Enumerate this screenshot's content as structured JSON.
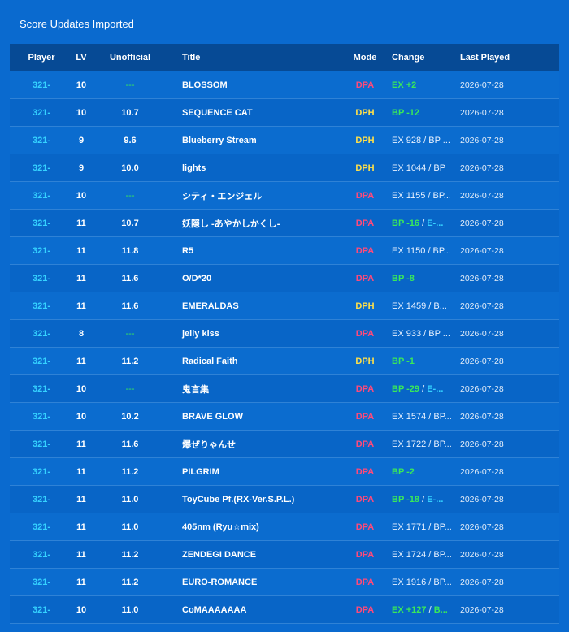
{
  "panel": {
    "title": "Score Updates Imported"
  },
  "columns": {
    "player": "Player",
    "lv": "LV",
    "unofficial": "Unofficial",
    "title": "Title",
    "mode": "Mode",
    "change": "Change",
    "last_played": "Last Played"
  },
  "colors": {
    "background": "#0a6acf",
    "header": "#064a95",
    "dpa": "#ff4a7a",
    "dph": "#ffe04a",
    "player": "#35d2ff",
    "green": "#39e85a"
  },
  "rows": [
    {
      "player": "321-",
      "lv": "10",
      "unofficial": "---",
      "title": "BLOSSOM",
      "mode": "DPA",
      "change_parts": [
        {
          "text": "EX +2",
          "style": "green"
        }
      ],
      "last_played": "2026-07-28"
    },
    {
      "player": "321-",
      "lv": "10",
      "unofficial": "10.7",
      "title": "SEQUENCE CAT",
      "mode": "DPH",
      "change_parts": [
        {
          "text": "BP -12",
          "style": "green"
        }
      ],
      "last_played": "2026-07-28"
    },
    {
      "player": "321-",
      "lv": "9",
      "unofficial": "9.6",
      "title": "Blueberry Stream",
      "mode": "DPH",
      "change_parts": [
        {
          "text": "EX 928 / BP ...",
          "style": "plain"
        }
      ],
      "last_played": "2026-07-28"
    },
    {
      "player": "321-",
      "lv": "9",
      "unofficial": "10.0",
      "title": "lights",
      "mode": "DPH",
      "change_parts": [
        {
          "text": "EX 1044 / BP",
          "style": "plain"
        }
      ],
      "last_played": "2026-07-28"
    },
    {
      "player": "321-",
      "lv": "10",
      "unofficial": "---",
      "title": "シティ・エンジェル",
      "mode": "DPA",
      "change_parts": [
        {
          "text": "EX 1155 / BP...",
          "style": "plain"
        }
      ],
      "last_played": "2026-07-28"
    },
    {
      "player": "321-",
      "lv": "11",
      "unofficial": "10.7",
      "title": "妖隠し -あやかしかくし-",
      "mode": "DPA",
      "change_parts": [
        {
          "text": "BP -16",
          "style": "green"
        },
        {
          "text": " / ",
          "style": "plain"
        },
        {
          "text": "E-...",
          "style": "blue"
        }
      ],
      "last_played": "2026-07-28"
    },
    {
      "player": "321-",
      "lv": "11",
      "unofficial": "11.8",
      "title": "R5",
      "mode": "DPA",
      "change_parts": [
        {
          "text": "EX 1150 / BP...",
          "style": "plain"
        }
      ],
      "last_played": "2026-07-28"
    },
    {
      "player": "321-",
      "lv": "11",
      "unofficial": "11.6",
      "title": "O/D*20",
      "mode": "DPA",
      "change_parts": [
        {
          "text": "BP -8",
          "style": "green"
        }
      ],
      "last_played": "2026-07-28"
    },
    {
      "player": "321-",
      "lv": "11",
      "unofficial": "11.6",
      "title": "EMERALDAS",
      "mode": "DPH",
      "change_parts": [
        {
          "text": "EX 1459 / B...",
          "style": "plain"
        }
      ],
      "last_played": "2026-07-28"
    },
    {
      "player": "321-",
      "lv": "8",
      "unofficial": "---",
      "title": "jelly kiss",
      "mode": "DPA",
      "change_parts": [
        {
          "text": "EX 933 / BP ...",
          "style": "plain"
        }
      ],
      "last_played": "2026-07-28"
    },
    {
      "player": "321-",
      "lv": "11",
      "unofficial": "11.2",
      "title": "Radical Faith",
      "mode": "DPH",
      "change_parts": [
        {
          "text": "BP -1",
          "style": "green"
        }
      ],
      "last_played": "2026-07-28"
    },
    {
      "player": "321-",
      "lv": "10",
      "unofficial": "---",
      "title": "鬼言集",
      "mode": "DPA",
      "change_parts": [
        {
          "text": "BP -29",
          "style": "green"
        },
        {
          "text": " / ",
          "style": "plain"
        },
        {
          "text": "E-...",
          "style": "blue"
        }
      ],
      "last_played": "2026-07-28"
    },
    {
      "player": "321-",
      "lv": "10",
      "unofficial": "10.2",
      "title": "BRAVE GLOW",
      "mode": "DPA",
      "change_parts": [
        {
          "text": "EX 1574 / BP...",
          "style": "plain"
        }
      ],
      "last_played": "2026-07-28"
    },
    {
      "player": "321-",
      "lv": "11",
      "unofficial": "11.6",
      "title": "爆ぜりゃんせ",
      "mode": "DPA",
      "change_parts": [
        {
          "text": "EX 1722 / BP...",
          "style": "plain"
        }
      ],
      "last_played": "2026-07-28"
    },
    {
      "player": "321-",
      "lv": "11",
      "unofficial": "11.2",
      "title": "PILGRIM",
      "mode": "DPA",
      "change_parts": [
        {
          "text": "BP -2",
          "style": "green"
        }
      ],
      "last_played": "2026-07-28"
    },
    {
      "player": "321-",
      "lv": "11",
      "unofficial": "11.0",
      "title": "ToyCube Pf.(RX-Ver.S.P.L.)",
      "mode": "DPA",
      "change_parts": [
        {
          "text": "BP -18",
          "style": "green"
        },
        {
          "text": " / ",
          "style": "plain"
        },
        {
          "text": "E-...",
          "style": "blue"
        }
      ],
      "last_played": "2026-07-28"
    },
    {
      "player": "321-",
      "lv": "11",
      "unofficial": "11.0",
      "title": "405nm (Ryu☆mix)",
      "mode": "DPA",
      "change_parts": [
        {
          "text": "EX 1771 / BP...",
          "style": "plain"
        }
      ],
      "last_played": "2026-07-28"
    },
    {
      "player": "321-",
      "lv": "11",
      "unofficial": "11.2",
      "title": "ZENDEGI DANCE",
      "mode": "DPA",
      "change_parts": [
        {
          "text": "EX 1724 / BP...",
          "style": "plain"
        }
      ],
      "last_played": "2026-07-28"
    },
    {
      "player": "321-",
      "lv": "11",
      "unofficial": "11.2",
      "title": "EURO-ROMANCE",
      "mode": "DPA",
      "change_parts": [
        {
          "text": "EX 1916 / BP...",
          "style": "plain"
        }
      ],
      "last_played": "2026-07-28"
    },
    {
      "player": "321-",
      "lv": "10",
      "unofficial": "11.0",
      "title": "CoMAAAAAAA",
      "mode": "DPA",
      "change_parts": [
        {
          "text": "EX +127",
          "style": "green"
        },
        {
          "text": " / ",
          "style": "plain"
        },
        {
          "text": "B...",
          "style": "green"
        }
      ],
      "last_played": "2026-07-28"
    }
  ]
}
